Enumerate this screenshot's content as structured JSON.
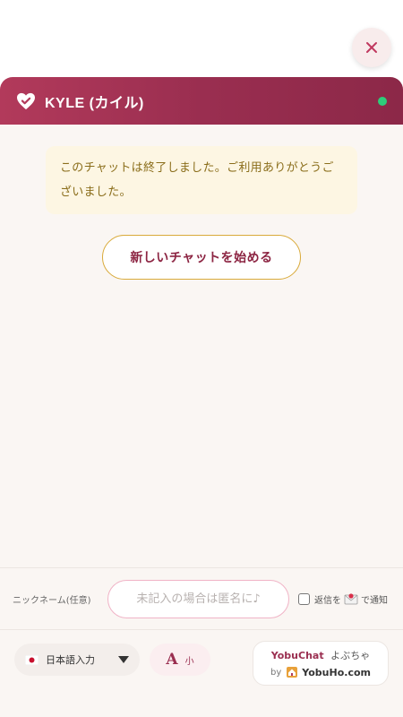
{
  "header": {
    "agent_name": "KYLE (カイル)",
    "status_color": "#2ecc7a",
    "logo_icon": "heart-check-icon"
  },
  "close_icon": "close-icon",
  "notice": {
    "text": "このチャットは終了しました。ご利用ありがとうございました。"
  },
  "new_chat_button": "新しいチャットを始める",
  "nickname": {
    "label": "ニックネーム(任意)",
    "placeholder": "未記入の場合は匿名に♪",
    "value": ""
  },
  "reply_notify": {
    "label_before": "返信を",
    "label_after": "で通知",
    "checked": false,
    "icon": "envelope-icon"
  },
  "footer": {
    "language": "日本語入力",
    "font_size": {
      "big": "A",
      "label": "小"
    },
    "brand": {
      "name": "YobuChat",
      "kana": "よぶちゃ",
      "by": "by",
      "site": "YobuHo.com"
    }
  },
  "colors": {
    "header_start": "#b23a5b",
    "header_end": "#8c2848",
    "accent": "#9a2e50",
    "button_border": "#d9aa3a",
    "notice_bg": "#fdf6e3"
  }
}
